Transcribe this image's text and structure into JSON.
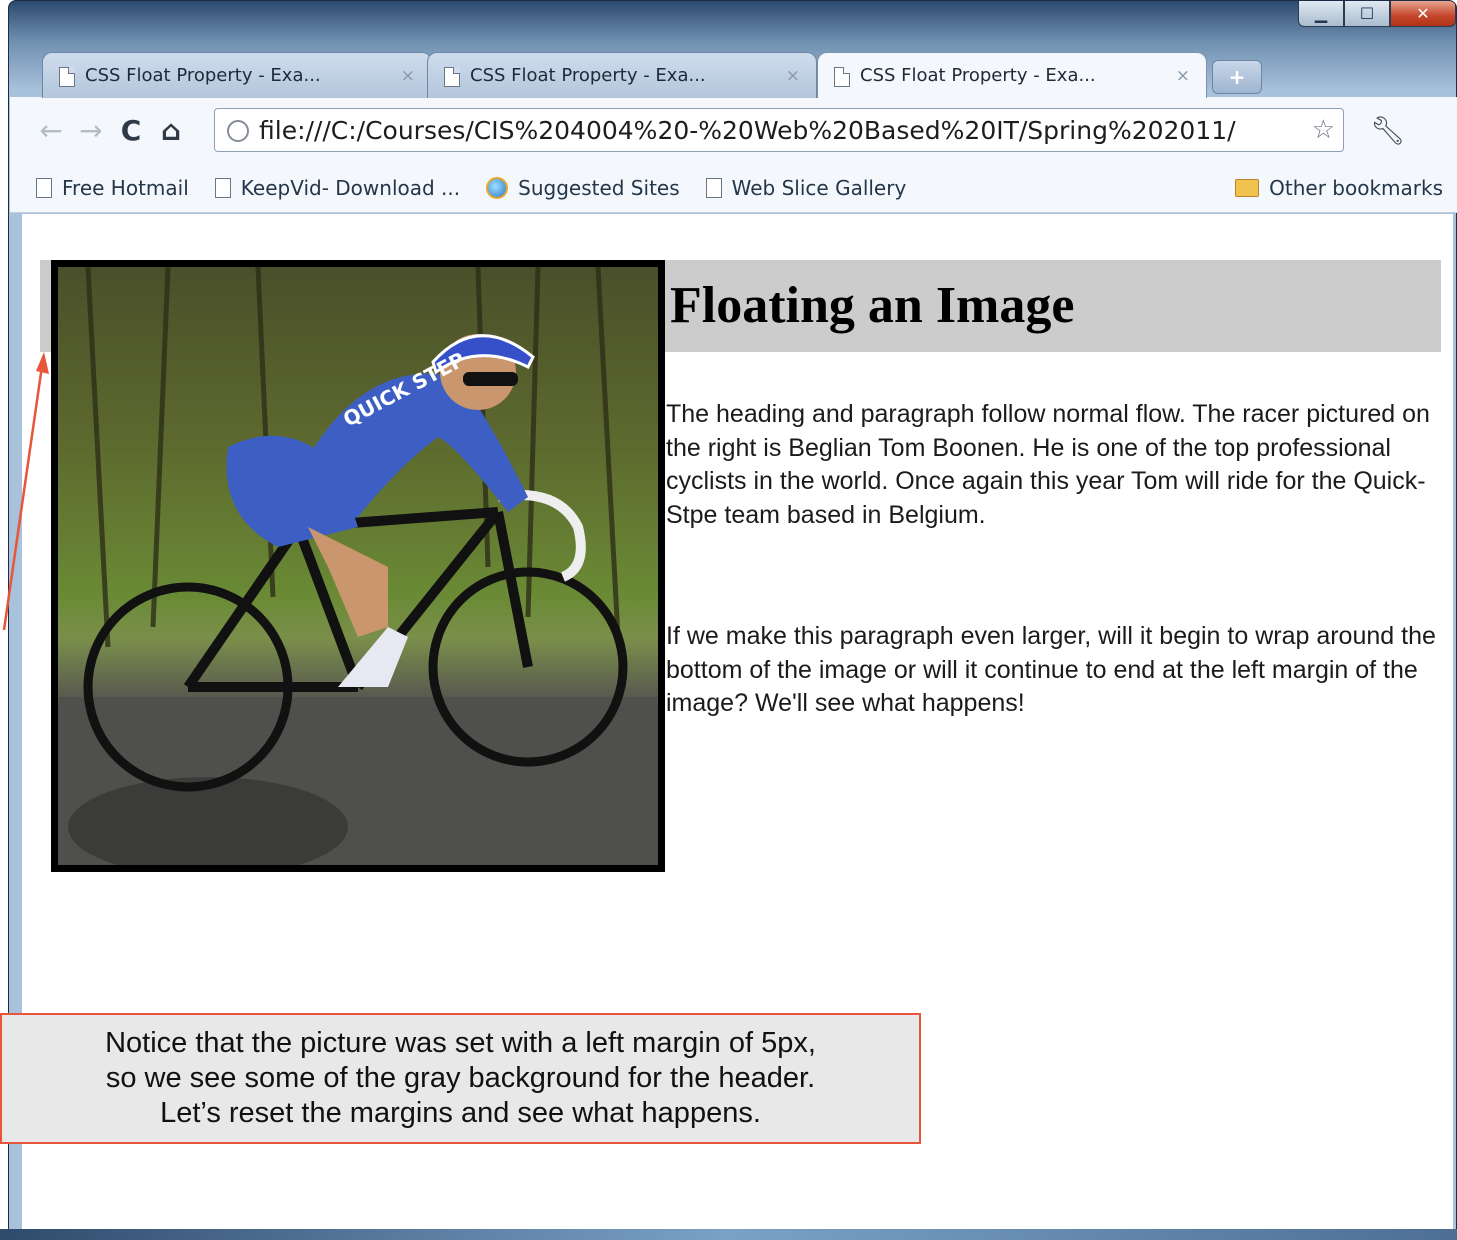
{
  "window": {
    "controls": [
      "minimize",
      "maximize",
      "close"
    ]
  },
  "tabs": [
    {
      "label": "CSS Float Property - Exa...",
      "close": "×"
    },
    {
      "label": "CSS Float Property - Exa...",
      "close": "×"
    },
    {
      "label": "CSS Float Property - Exa...",
      "close": "×",
      "active": true
    }
  ],
  "toolbar": {
    "url": "file:///C:/Courses/CIS%204004%20-%20Web%20Based%20IT/Spring%202011/"
  },
  "bookmarks": {
    "items": [
      "Free Hotmail",
      "KeepVid- Download ...",
      "Suggested Sites",
      "Web Slice Gallery"
    ],
    "other": "Other bookmarks"
  },
  "page": {
    "heading": "Floating an Image",
    "paragraph1": "The heading and paragraph follow normal flow. The racer pictured on the right is Beglian Tom Boonen. He is one of the top professional cyclists in the world. Once again this year Tom will ride for the Quick-Stpe team based in Belgium.",
    "paragraph2": "If we make this paragraph even larger, will it begin to wrap around the bottom of the image or will it continue to end at the left margin of the image? We'll see what happens!",
    "image_jersey_text": "QUICK STEP"
  },
  "callout": {
    "line1": "Notice that the picture was set with a left margin of 5px,",
    "line2": "so we see some of the gray background for the header.",
    "line3": "Let’s reset the margins and see what happens."
  },
  "colors": {
    "header_background": "#cccccc",
    "callout_border": "#e8553a",
    "arrow": "#e8553a"
  }
}
